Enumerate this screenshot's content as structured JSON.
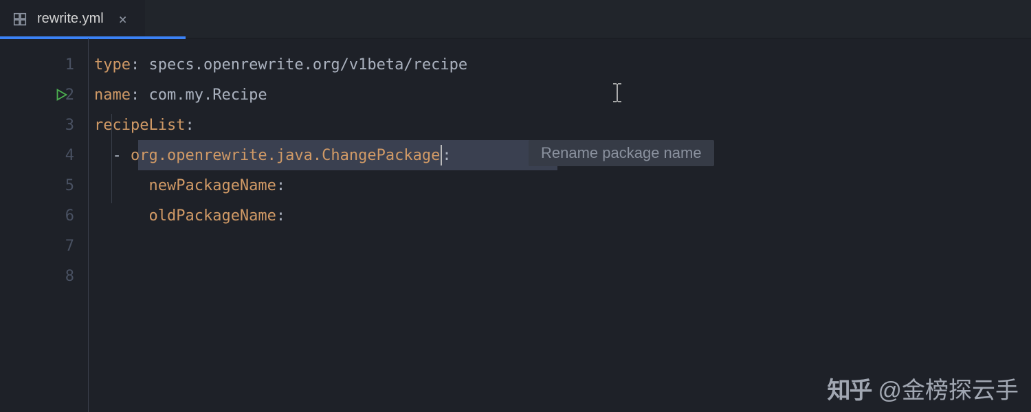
{
  "tab": {
    "filename": "rewrite.yml",
    "close_label": "×"
  },
  "gutter": {
    "lines": [
      "1",
      "2",
      "3",
      "4",
      "5",
      "6",
      "7",
      "8"
    ]
  },
  "code": {
    "l1_key": "type",
    "l1_sep": ": ",
    "l1_val": "specs.openrewrite.org/v1beta/recipe",
    "l2_key": "name",
    "l2_sep": ": ",
    "l2_val": "com.my.Recipe",
    "l3_key": "recipeList",
    "l3_sep": ":",
    "l4_indent": "  ",
    "l4_dash": "- ",
    "l4_key": "org.openrewrite.java.ChangePackage",
    "l4_sep": ":",
    "l5_indent": "      ",
    "l5_key": "newPackageName",
    "l5_sep": ":",
    "l6_indent": "      ",
    "l6_key": "oldPackageName",
    "l6_sep": ":"
  },
  "hint": {
    "text": "Rename package name"
  },
  "watermark": {
    "logo": "知乎",
    "handle": "@金榜探云手"
  }
}
